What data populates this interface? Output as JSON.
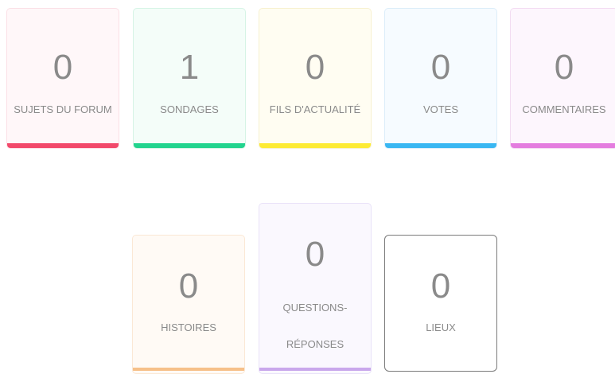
{
  "cards": [
    {
      "count": "0",
      "label": "SUJETS DU FORUM",
      "accent": "#f2496b"
    },
    {
      "count": "1",
      "label": "SONDAGES",
      "accent": "#22d48e"
    },
    {
      "count": "0",
      "label": "FILS D'ACTUALITÉ",
      "accent": "#fdeb34"
    },
    {
      "count": "0",
      "label": "VOTES",
      "accent": "#39b7f2"
    },
    {
      "count": "0",
      "label": "COMMENTAIRES",
      "accent": "#e47ddf"
    },
    {
      "count": "0",
      "label": "HISTOIRES",
      "accent": "#f6c089"
    },
    {
      "count": "0",
      "label_line1": "QUESTIONS-",
      "label_line2": "RÉPONSES",
      "accent": "#c9a8ec"
    },
    {
      "count": "0",
      "label": "LIEUX",
      "accent": "#7a7a7a"
    }
  ]
}
